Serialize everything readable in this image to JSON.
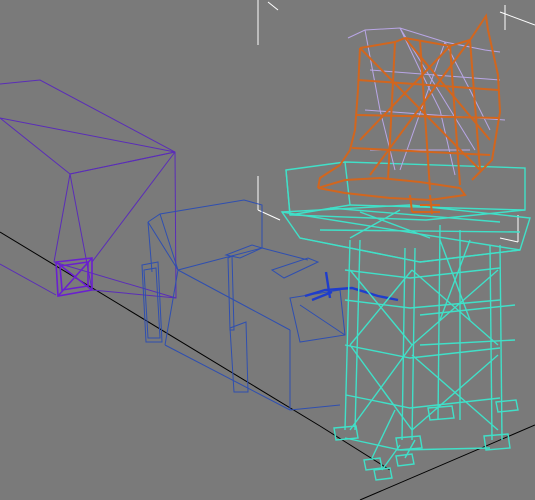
{
  "viewport": {
    "background": "#7a7a7a",
    "grid_color": "#000000",
    "colors": {
      "purple_box": "#5a2db8",
      "blue_building": "#2f4fb0",
      "teal_tower": "#40e0c8",
      "orange_radar": "#d2661e",
      "lilac_radar": "#b9a6e6",
      "white_selection": "#ffffff",
      "selected_blue": "#1f3dcc"
    },
    "objects": [
      "purple-box",
      "blue-building",
      "teal-tower",
      "radar-dish",
      "selection-bracket"
    ]
  }
}
